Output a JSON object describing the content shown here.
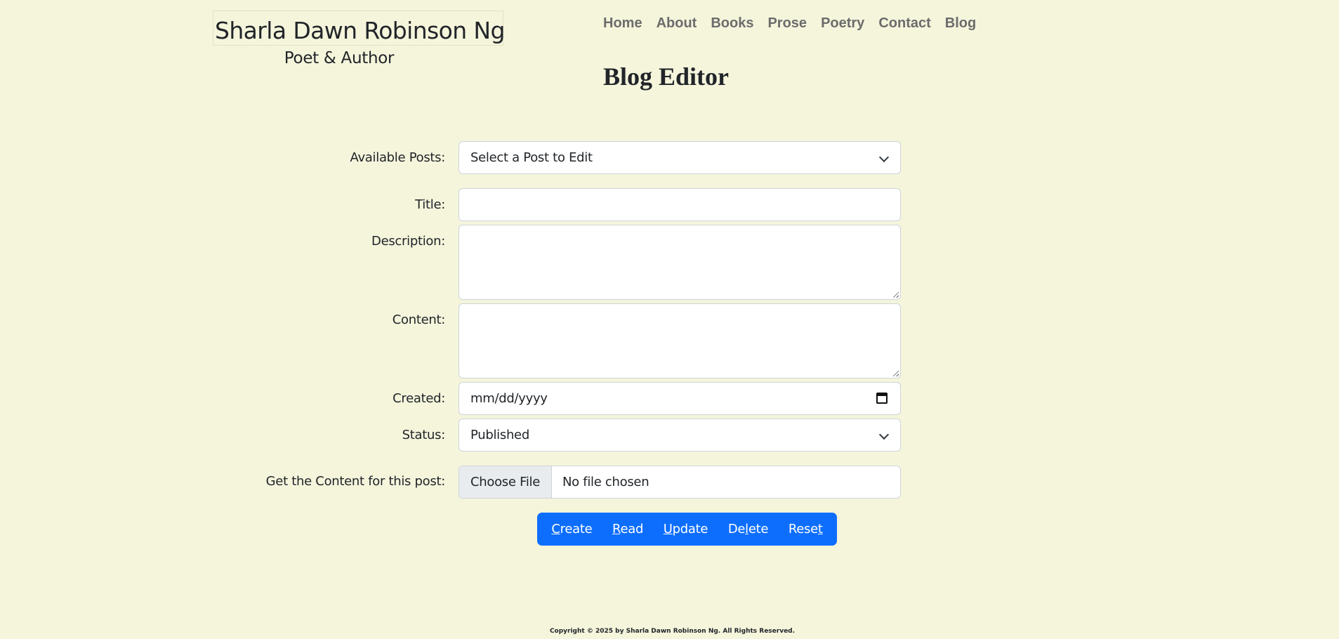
{
  "brand": {
    "name": "Sharla Dawn Robinson Ng",
    "subtitle": "Poet & Author"
  },
  "nav": {
    "items": [
      "Home",
      "About",
      "Books",
      "Prose",
      "Poetry",
      "Contact",
      "Blog"
    ]
  },
  "page_title": "Blog Editor",
  "form": {
    "available_posts": {
      "label": "Available Posts:",
      "selected": "Select a Post to Edit"
    },
    "title": {
      "label": "Title:",
      "value": ""
    },
    "description": {
      "label": "Description:",
      "value": ""
    },
    "content": {
      "label": "Content:",
      "value": ""
    },
    "created": {
      "label": "Created:",
      "placeholder": "mm/dd/yyyy"
    },
    "status": {
      "label": "Status:",
      "selected": "Published"
    },
    "file": {
      "label": "Get the Content for this post:",
      "button": "Choose File",
      "status": "No file chosen"
    }
  },
  "actions": {
    "create": {
      "accel": "C",
      "rest": "reate"
    },
    "read": {
      "accel": "R",
      "rest": "ead"
    },
    "update": {
      "accel": "U",
      "rest": "pdate"
    },
    "delete": {
      "pre": "De",
      "accel": "l",
      "rest": "ete"
    },
    "reset": {
      "pre": "Rese",
      "accel": "t",
      "rest": ""
    }
  },
  "footer": "Copyright © 2025 by Sharla Dawn Robinson Ng. All Rights Reserved.",
  "colors": {
    "background": "#f5f5dc",
    "accent": "#0d6efd",
    "nav_text": "#6c6c6c"
  }
}
